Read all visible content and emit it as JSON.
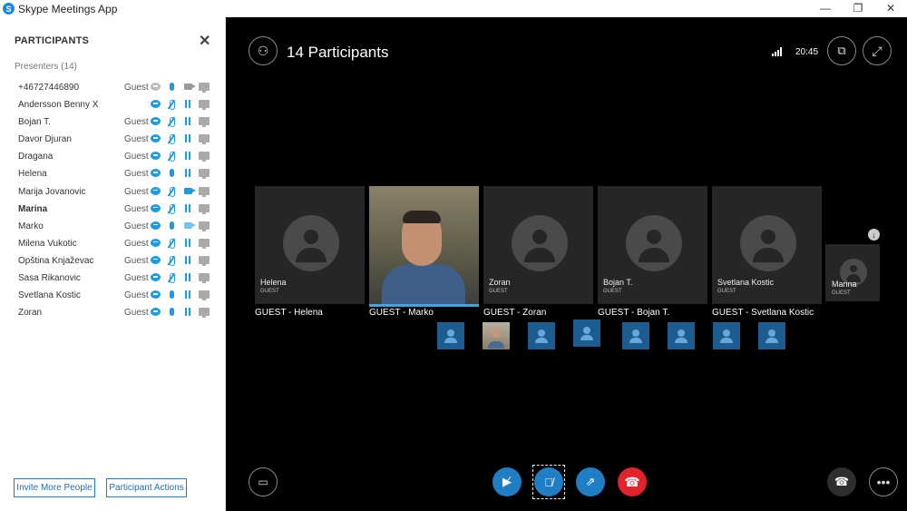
{
  "window": {
    "title": "Skype Meetings App",
    "controls": [
      "—",
      "❐",
      "✕"
    ]
  },
  "sidebar": {
    "title": "PARTICIPANTS",
    "close": "✕",
    "section": "Presenters (14)",
    "participants": [
      {
        "name": "+46727446890",
        "role": "Guest",
        "chat": "gray",
        "mic": "on",
        "video": "gray",
        "bold": false
      },
      {
        "name": "Andersson Benny X",
        "role": "",
        "chat": "blue",
        "mic": "muted",
        "video": "paused",
        "bold": false
      },
      {
        "name": "Bojan T.",
        "role": "Guest",
        "chat": "blue",
        "mic": "muted",
        "video": "paused",
        "bold": false
      },
      {
        "name": "Davor Djuran",
        "role": "Guest",
        "chat": "blue",
        "mic": "muted",
        "video": "paused",
        "bold": false
      },
      {
        "name": "Dragana",
        "role": "Guest",
        "chat": "blue",
        "mic": "muted",
        "video": "paused",
        "bold": false
      },
      {
        "name": "Helena",
        "role": "Guest",
        "chat": "blue",
        "mic": "on",
        "video": "paused",
        "bold": false
      },
      {
        "name": "Marija Jovanovic",
        "role": "Guest",
        "chat": "blue",
        "mic": "muted",
        "video": "blue",
        "bold": false
      },
      {
        "name": "Marina",
        "role": "Guest",
        "chat": "blue",
        "mic": "muted",
        "video": "paused",
        "bold": true
      },
      {
        "name": "Marko",
        "role": "Guest",
        "chat": "blue",
        "mic": "on",
        "video": "light",
        "bold": false
      },
      {
        "name": "Milena Vukotic",
        "role": "Guest",
        "chat": "blue",
        "mic": "muted",
        "video": "paused",
        "bold": false
      },
      {
        "name": "Opština Knjaževac",
        "role": "Guest",
        "chat": "blue",
        "mic": "muted",
        "video": "paused",
        "bold": false
      },
      {
        "name": "Sasa Rikanovic",
        "role": "Guest",
        "chat": "blue",
        "mic": "muted",
        "video": "paused",
        "bold": false
      },
      {
        "name": "Svetlana Kostic",
        "role": "Guest",
        "chat": "blue",
        "mic": "on",
        "video": "paused",
        "bold": false
      },
      {
        "name": "Zoran",
        "role": "Guest",
        "chat": "blue",
        "mic": "on",
        "video": "paused",
        "bold": false
      }
    ],
    "invite_label": "Invite More People",
    "actions_label": "Participant Actions"
  },
  "stage": {
    "participants_title": "14 Participants",
    "clock": "20:45",
    "tiles": [
      {
        "name": "Helena",
        "role": "GUEST",
        "label": "GUEST - Helena",
        "type": "avatar"
      },
      {
        "name": "",
        "role": "",
        "label": "GUEST - Marko",
        "type": "video"
      },
      {
        "name": "Zoran",
        "role": "GUEST",
        "label": "GUEST - Zoran",
        "type": "avatar"
      },
      {
        "name": "Bojan T.",
        "role": "GUEST",
        "label": "GUEST - Bojan T.",
        "type": "avatar"
      },
      {
        "name": "Svetlana Kostic",
        "role": "GUEST",
        "label": "GUEST - Svetlana Kostic",
        "type": "avatar"
      }
    ],
    "small_tile": {
      "name": "Marina",
      "role": "GUEST"
    },
    "thumbnail_count": 8
  },
  "colors": {
    "accent": "#1f7ec4",
    "hangup": "#e2222c",
    "stage_bg": "#000000"
  }
}
